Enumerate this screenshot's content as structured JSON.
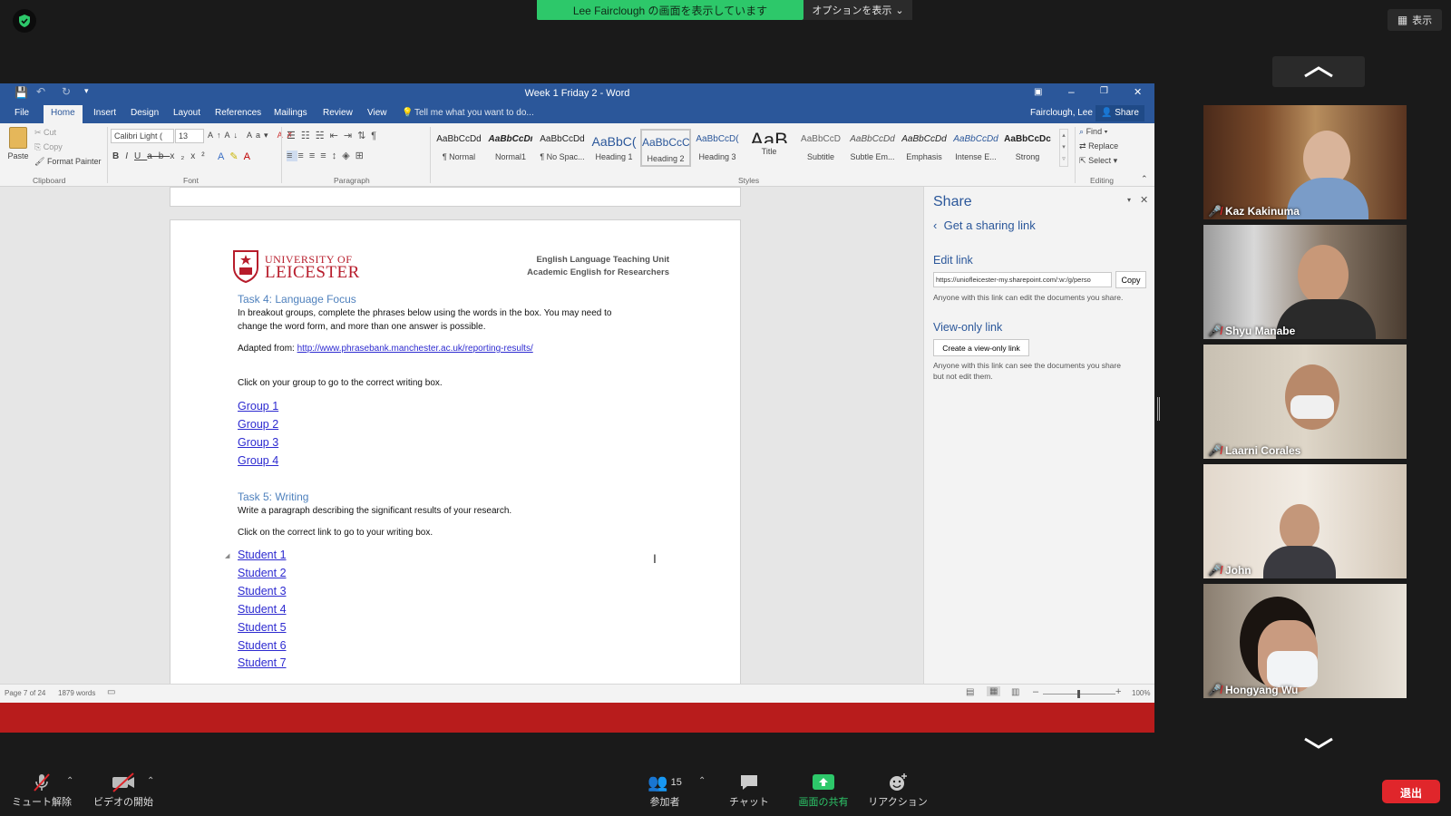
{
  "zoom": {
    "share_banner": "Lee Fairclough の画面を表示しています",
    "options_label": "オプションを表示",
    "view_label": "表示",
    "bottom": {
      "mute": "ミュート解除",
      "video": "ビデオの開始",
      "participants_label": "参加者",
      "participants_count": "15",
      "chat": "チャット",
      "share_screen": "画面の共有",
      "reactions": "リアクション",
      "leave": "退出"
    },
    "participants": [
      {
        "name": "Kaz Kakinuma"
      },
      {
        "name": "Shyu Manabe"
      },
      {
        "name": "Laarni Corales"
      },
      {
        "name": "John"
      },
      {
        "name": "Hongyang Wu"
      }
    ]
  },
  "word": {
    "title": "Week 1 Friday 2 - Word",
    "user": "Fairclough, Lee",
    "share_btn": "Share",
    "tabs": [
      "File",
      "Home",
      "Insert",
      "Design",
      "Layout",
      "References",
      "Mailings",
      "Review",
      "View"
    ],
    "tell_me": "Tell me what you want to do...",
    "clipboard": {
      "paste": "Paste",
      "cut": "Cut",
      "copy": "Copy",
      "format_painter": "Format Painter",
      "label": "Clipboard"
    },
    "font": {
      "name": "Calibri Light (",
      "size": "13",
      "label": "Font"
    },
    "paragraph_label": "Paragraph",
    "styles_label": "Styles",
    "styles": [
      {
        "preview": "AaBbCcDd",
        "name": "¶ Normal"
      },
      {
        "preview": "AaBbCcDı",
        "name": "Normal1"
      },
      {
        "preview": "AaBbCcDd",
        "name": "¶ No Spac..."
      },
      {
        "preview": "AaBbC(",
        "name": "Heading 1"
      },
      {
        "preview": "AaBbCcC",
        "name": "Heading 2"
      },
      {
        "preview": "AaBbCcD(",
        "name": "Heading 3"
      },
      {
        "preview": "AaB",
        "name": "Title"
      },
      {
        "preview": "AaBbCcD",
        "name": "Subtitle"
      },
      {
        "preview": "AaBbCcDd",
        "name": "Subtle Em..."
      },
      {
        "preview": "AaBbCcDd",
        "name": "Emphasis"
      },
      {
        "preview": "AaBbCcDd",
        "name": "Intense E..."
      },
      {
        "preview": "AaBbCcDc",
        "name": "Strong"
      }
    ],
    "editing": {
      "find": "Find",
      "replace": "Replace",
      "select": "Select",
      "label": "Editing"
    },
    "document": {
      "logo_line1": "UNIVERSITY OF",
      "logo_line2": "LEICESTER",
      "unit_line1": "English Language Teaching Unit",
      "unit_line2": "Academic English for Researchers",
      "task4_heading": "Task 4: Language Focus",
      "task4_para1": "In breakout groups, complete the phrases below using the words in the box.  You may need to",
      "task4_para2": "change the word form, and more than one answer is possible.",
      "adapted_label": "Adapted from: ",
      "adapted_link": "http://www.phrasebank.manchester.ac.uk/reporting-results/",
      "click_group": "Click on your group to go to the correct writing box.",
      "groups": [
        "Group 1",
        "Group 2",
        "Group 3",
        "Group 4"
      ],
      "task5_heading": "Task 5: Writing",
      "task5_para": "Write a paragraph describing the significant results of your research.",
      "click_link": "Click on the correct link to go to your writing box.",
      "students": [
        "Student 1",
        "Student 2",
        "Student 3",
        "Student 4",
        "Student 5",
        "Student 6",
        "Student 7"
      ]
    },
    "share_pane": {
      "title": "Share",
      "get_link": "Get a sharing link",
      "edit_link_title": "Edit link",
      "edit_link_url": "https://uniofleicester-my.sharepoint.com/:w:/g/perso",
      "copy": "Copy",
      "edit_desc": "Anyone with this link can edit the documents you share.",
      "view_link_title": "View-only link",
      "create_view_btn": "Create a view-only link",
      "view_desc1": "Anyone with this link can see the documents you share",
      "view_desc2": "but not edit them."
    },
    "status": {
      "page": "Page 7 of 24",
      "words": "1879 words",
      "zoom": "100%"
    }
  }
}
